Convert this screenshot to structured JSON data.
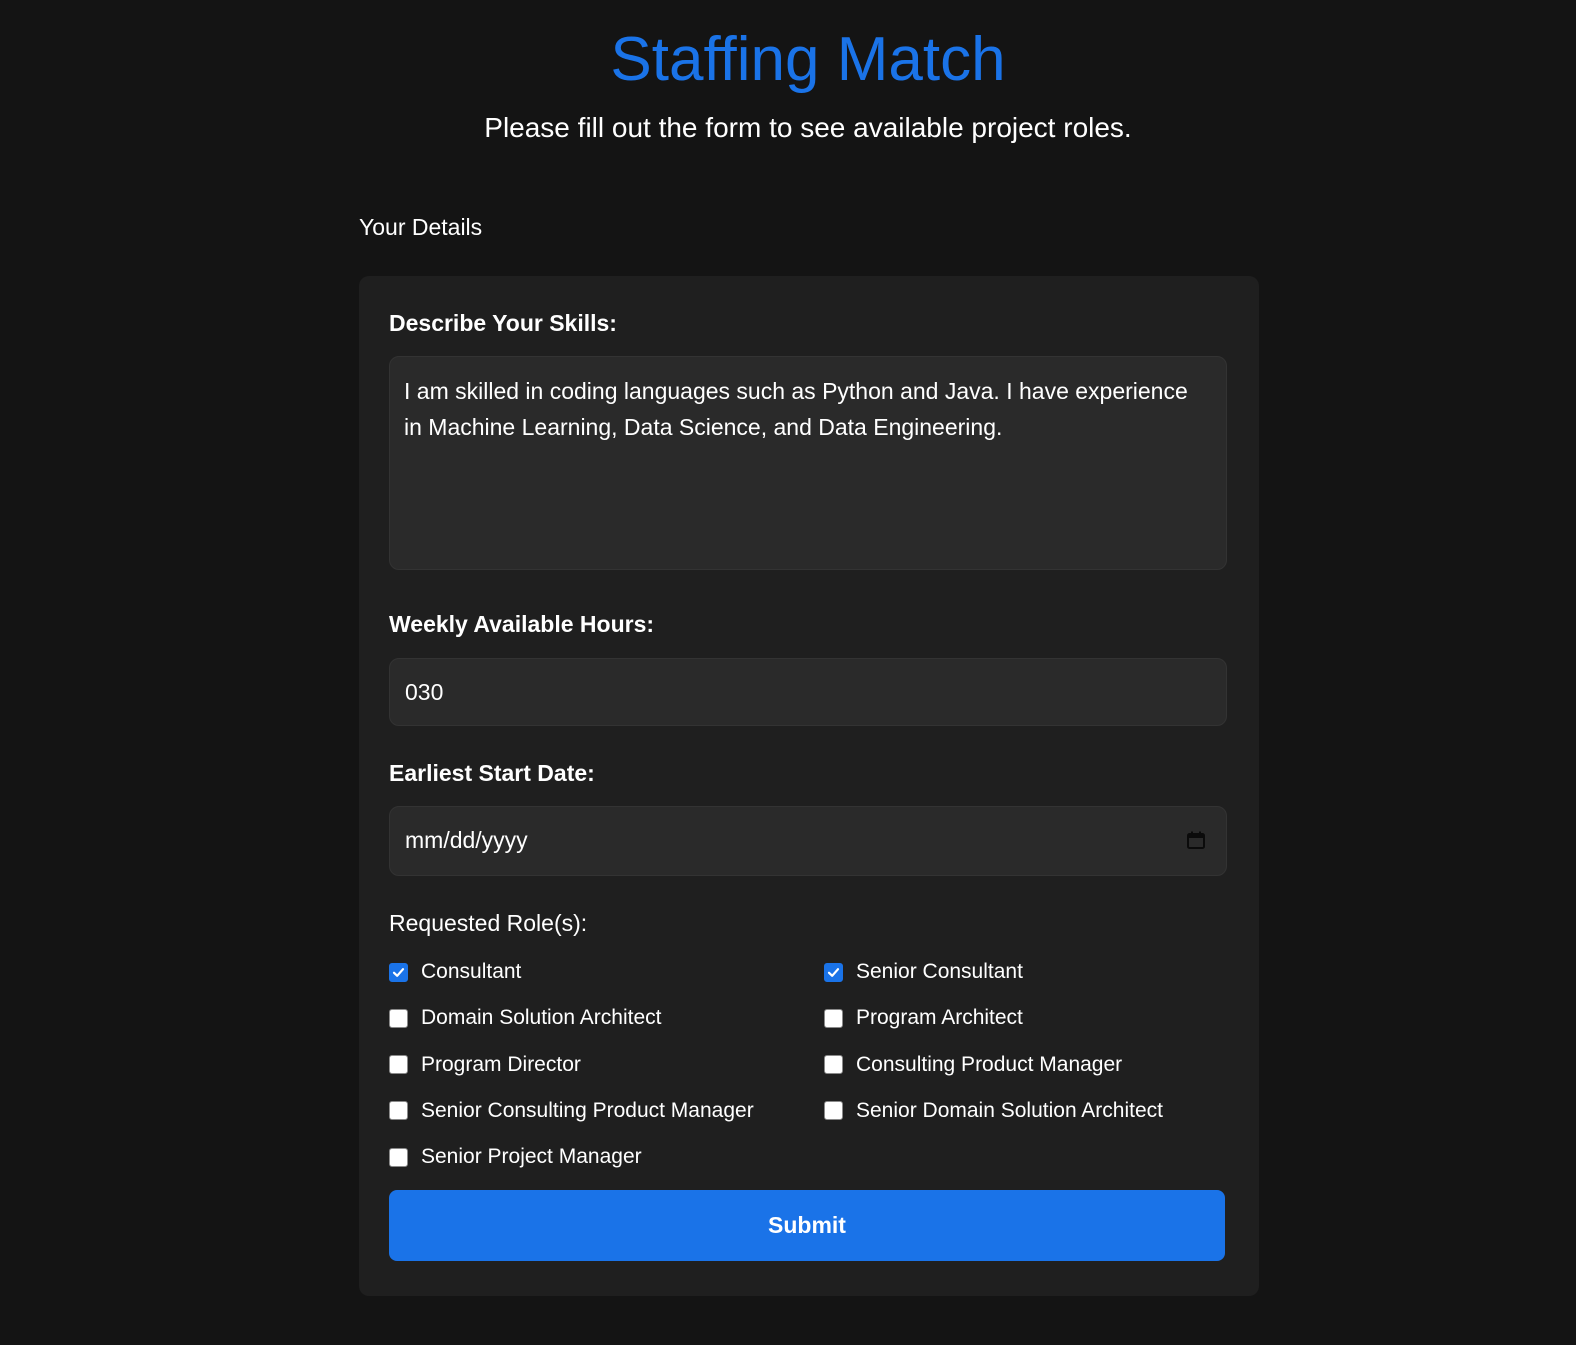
{
  "header": {
    "title": "Staffing Match",
    "subtitle": "Please fill out the form to see available project roles."
  },
  "form": {
    "section_label": "Your Details",
    "skills": {
      "label": "Describe Your Skills:",
      "value": "I am skilled in coding languages such as Python and Java. I have experience in Machine Learning, Data Science, and Data Engineering."
    },
    "hours": {
      "label": "Weekly Available Hours:",
      "value": "030"
    },
    "start_date": {
      "label": "Earliest Start Date:",
      "placeholder": "mm/dd/yyyy",
      "icon": "calendar-icon"
    },
    "roles": {
      "label": "Requested Role(s):",
      "items": [
        {
          "label": "Consultant",
          "checked": true
        },
        {
          "label": "Senior Consultant",
          "checked": true
        },
        {
          "label": "Domain Solution Architect",
          "checked": false
        },
        {
          "label": "Program Architect",
          "checked": false
        },
        {
          "label": "Program Director",
          "checked": false
        },
        {
          "label": "Consulting Product Manager",
          "checked": false
        },
        {
          "label": "Senior Consulting Product Manager",
          "checked": false
        },
        {
          "label": "Senior Domain Solution Architect",
          "checked": false
        },
        {
          "label": "Senior Project Manager",
          "checked": false
        }
      ]
    },
    "submit_label": "Submit"
  },
  "colors": {
    "background": "#141414",
    "card": "#1f1f1f",
    "accent": "#1a73e8",
    "input_bg": "#2a2a2a"
  }
}
